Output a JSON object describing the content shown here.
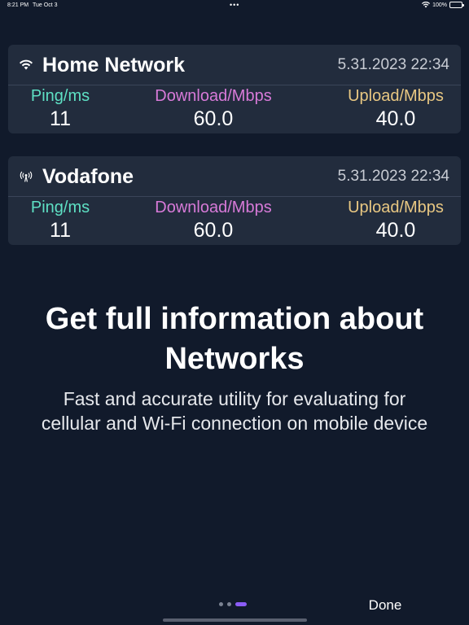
{
  "status_bar": {
    "time": "8:21 PM",
    "date": "Tue Oct 3",
    "dots": "•••",
    "battery": "100%"
  },
  "networks": [
    {
      "name": "Home Network",
      "icon": "wifi-icon",
      "timestamp": "5.31.2023 22:34",
      "ping_label": "Ping/ms",
      "ping_value": "11",
      "download_label": "Download/Mbps",
      "download_value": "60.0",
      "upload_label": "Upload/Mbps",
      "upload_value": "40.0"
    },
    {
      "name": "Vodafone",
      "icon": "cellular-antenna-icon",
      "timestamp": "5.31.2023 22:34",
      "ping_label": "Ping/ms",
      "ping_value": "11",
      "download_label": "Download/Mbps",
      "download_value": "60.0",
      "upload_label": "Upload/Mbps",
      "upload_value": "40.0"
    }
  ],
  "promo": {
    "title_line1": "Get full information about",
    "title_line2": "Networks",
    "subtitle_line1": "Fast and accurate utility for evaluating for",
    "subtitle_line2": "cellular and Wi-Fi connection on mobile device"
  },
  "pager": {
    "total": 3,
    "current": 3
  },
  "footer": {
    "done_label": "Done"
  },
  "colors": {
    "background": "#111a2b",
    "card": "#222c3d",
    "ping": "#5ee0c4",
    "download": "#d77ad8",
    "upload": "#e8c782",
    "active_dot": "#8b5cf6"
  }
}
